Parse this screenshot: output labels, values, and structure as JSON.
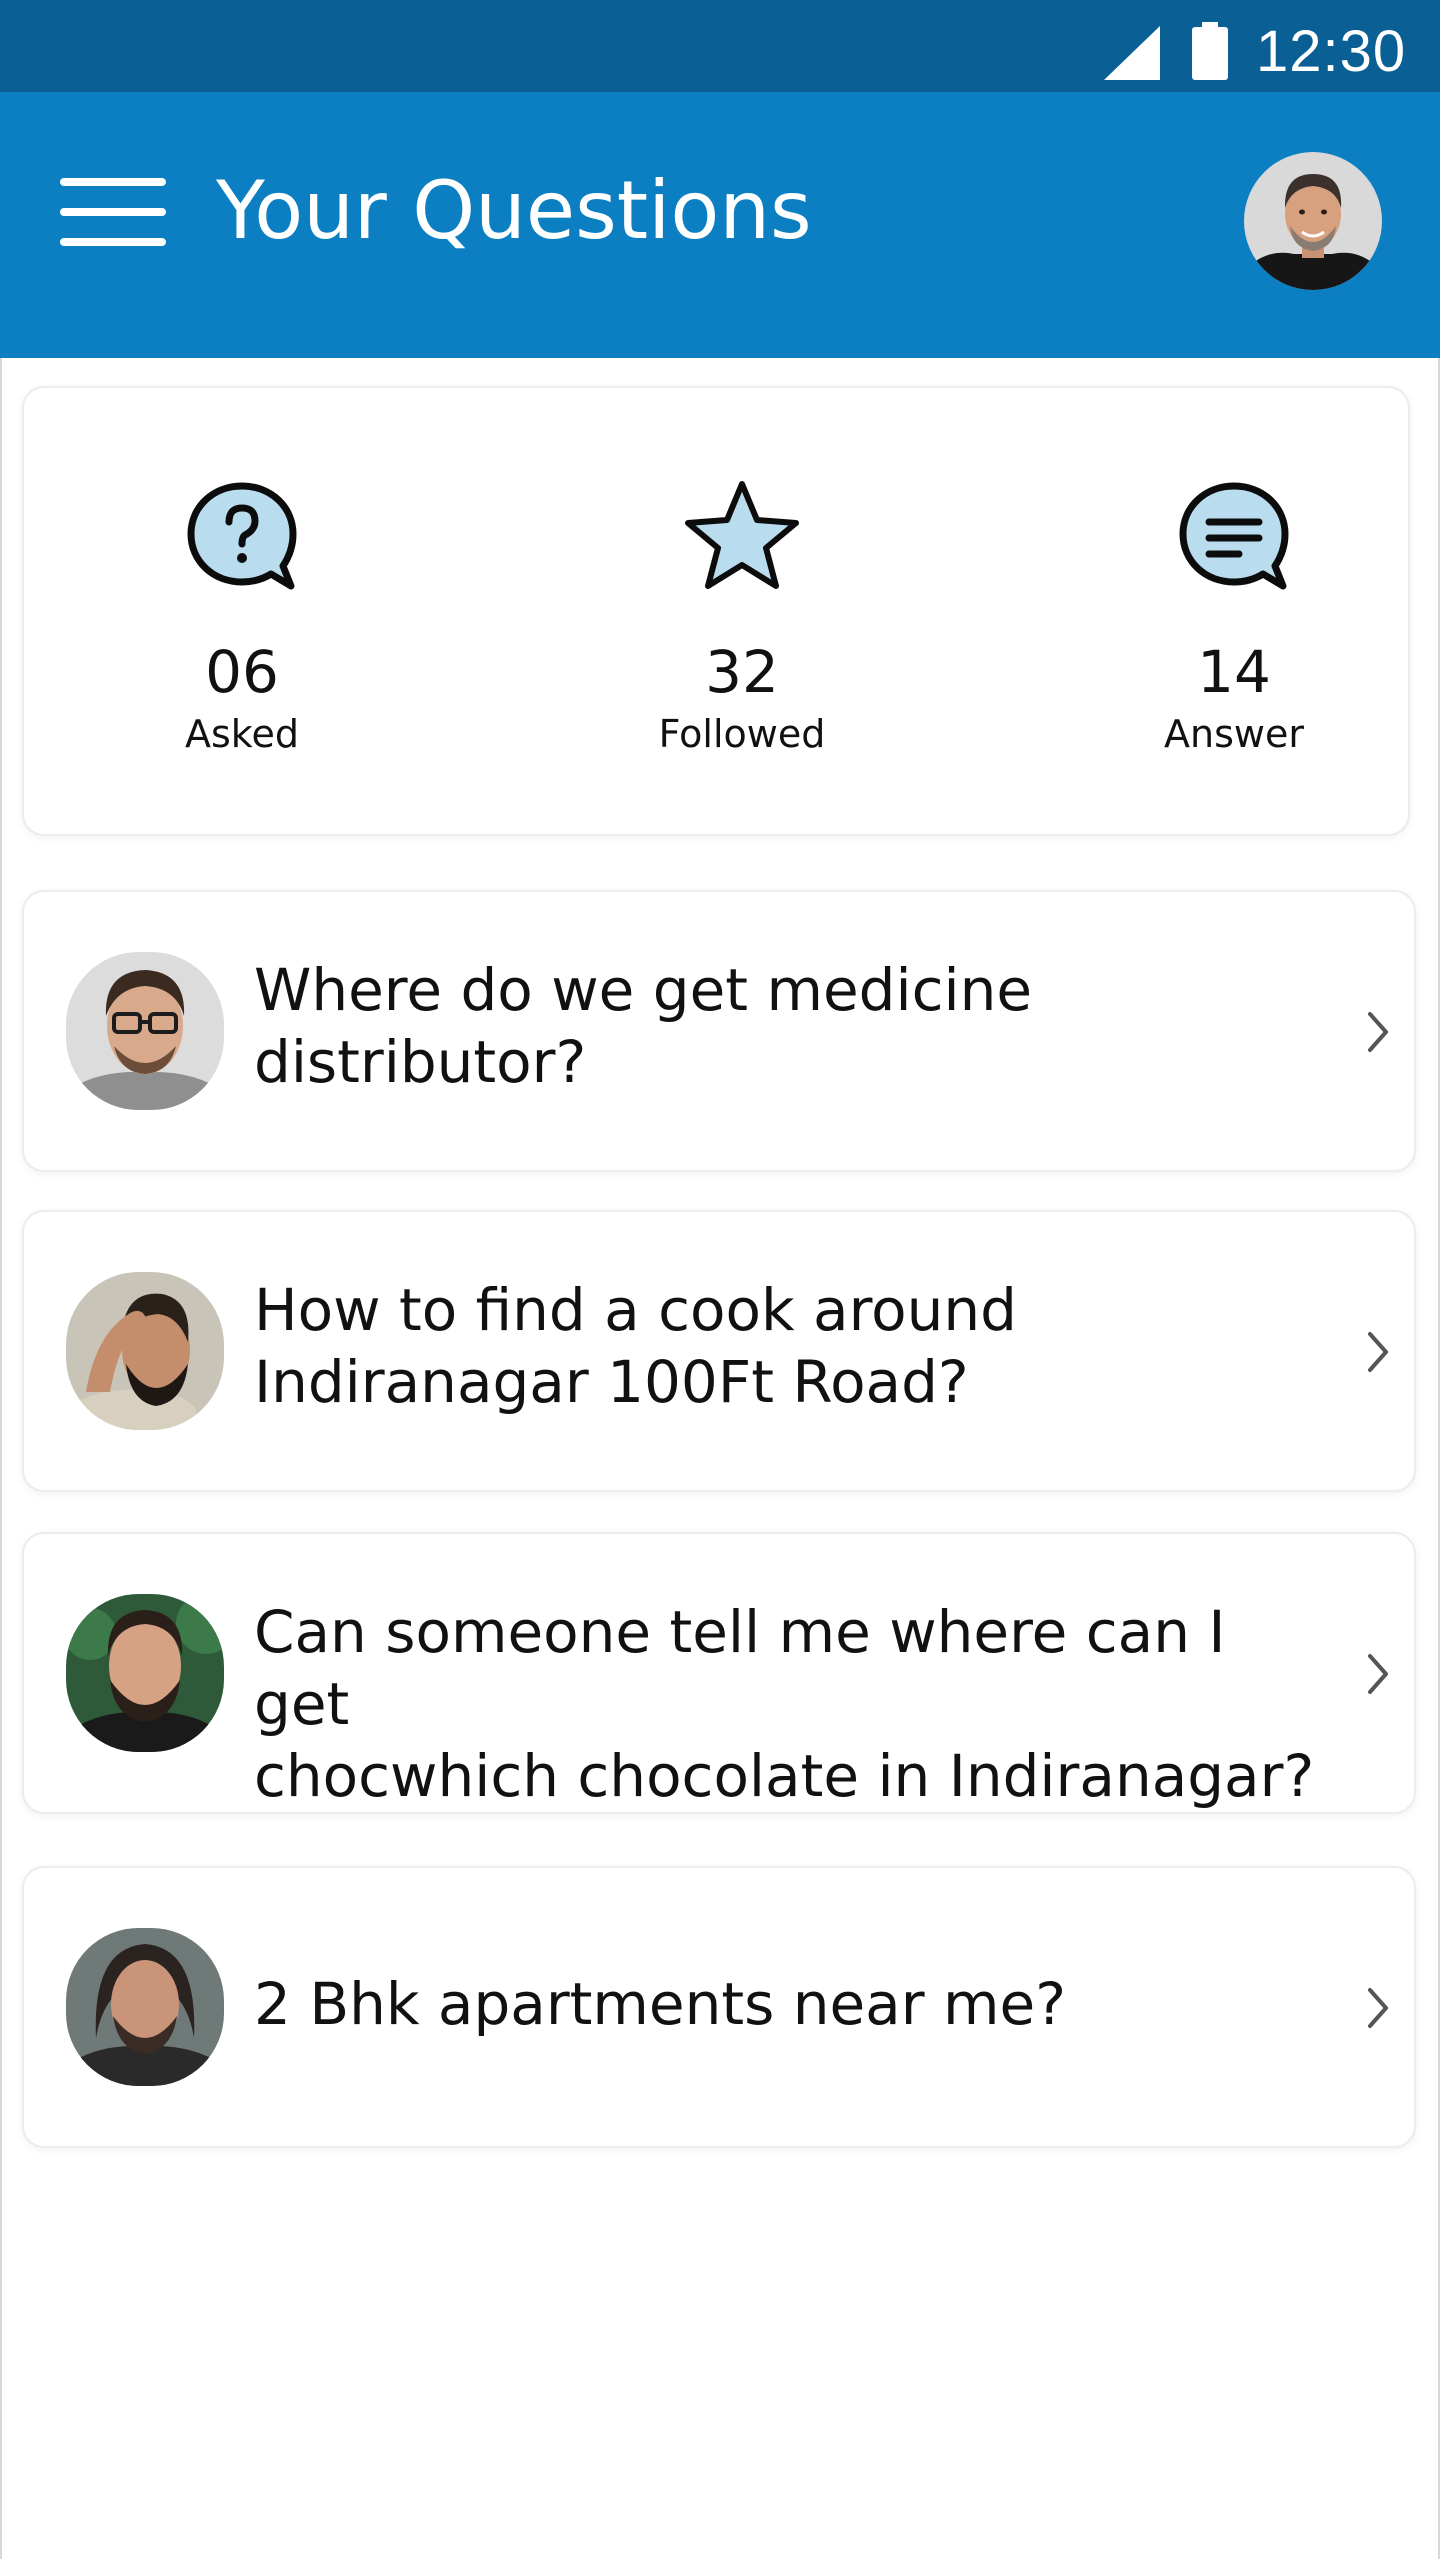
{
  "status_bar": {
    "time": "12:30",
    "icons": [
      "signal-icon",
      "battery-icon"
    ]
  },
  "app_bar": {
    "menu_icon": "hamburger-menu-icon",
    "title": "Your Questions",
    "avatar": "profile-avatar"
  },
  "stats": [
    {
      "icon": "question-bubble-icon",
      "value": "06",
      "label": "Asked"
    },
    {
      "icon": "star-icon",
      "value": "32",
      "label": "Followed"
    },
    {
      "icon": "message-bubble-icon",
      "value": "14",
      "label": "Answer"
    }
  ],
  "questions": [
    {
      "line1": "Where do we get medicine",
      "line2": "distributor?",
      "avatar": "user-avatar-glasses"
    },
    {
      "line1": "How to find a cook around",
      "line2": "Indiranagar 100Ft Road?",
      "avatar": "user-avatar-beard-hand"
    },
    {
      "line1": "Can someone tell me where can I get",
      "line2": "chocwhich chocolate in Indiranagar?",
      "avatar": "user-avatar-beard-outdoor"
    },
    {
      "line1": "2 Bhk apartments near me?",
      "line2": "",
      "avatar": "user-avatar-long-hair"
    }
  ],
  "colors": {
    "status_bar": "#0a5f94",
    "app_bar": "#0b7fc1",
    "icon_fill": "#b9dcef",
    "icon_stroke": "#0c0c0c"
  }
}
